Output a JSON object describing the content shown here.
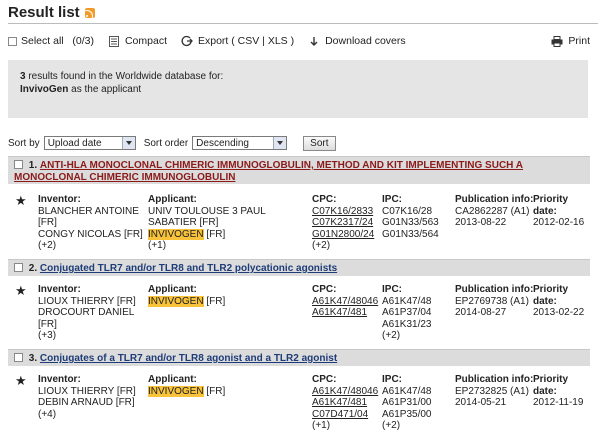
{
  "header": {
    "title": "Result list",
    "rss_icon": "rss-icon"
  },
  "toolbar": {
    "select_all": "Select all",
    "select_count": "(0/3)",
    "compact": "Compact",
    "export": "Export",
    "export_formats": "( CSV | XLS )",
    "download": "Download covers",
    "print": "Print"
  },
  "summary": {
    "count": "3",
    "line1_rest": " results found in the Worldwide database for:",
    "query": "InvivoGen",
    "line2_rest": " as the applicant"
  },
  "sort": {
    "sort_by_label": "Sort by",
    "sort_by_value": "Upload date",
    "sort_order_label": "Sort order",
    "sort_order_value": "Descending",
    "sort_button": "Sort"
  },
  "labels": {
    "inventor": "Inventor:",
    "applicant": "Applicant:",
    "cpc": "CPC:",
    "ipc": "IPC:",
    "publication": "Publication info:",
    "priority": "Priority date:"
  },
  "results": [
    {
      "num": "1.",
      "title": "ANTI-HLA MONOCLONAL CHIMERIC IMMUNOGLOBULIN, METHOD AND KIT IMPLEMENTING SUCH A MONOCLONAL CHIMERIC IMMUNOGLOBULIN",
      "inventors": [
        "BLANCHER ANTOINE",
        "[FR]",
        "CONGY NICOLAS  [FR]",
        "(+2)"
      ],
      "applicants": [
        "UNIV TOULOUSE 3 PAUL",
        "SABATIER  [FR]"
      ],
      "applicant_highlight": "INVIVOGEN",
      "applicant_highlight_suffix": "  [FR]",
      "applicant_more": "(+1)",
      "cpc": [
        "C07K16/2833",
        "C07K2317/24",
        "G01N2800/24"
      ],
      "cpc_more": "(+2)",
      "ipc": [
        "C07K16/28",
        "G01N33/563",
        "G01N33/564"
      ],
      "ipc_more": "",
      "pub_number": "CA2862287 (A1)",
      "pub_date": "2013-08-22",
      "priority": "2012-02-16"
    },
    {
      "num": "2.",
      "title": "Conjugated TLR7 and/or TLR8 and TLR2 polycationic agonists",
      "inventors": [
        "LIOUX THIERRY  [FR]",
        "DROCOURT DANIEL",
        "[FR]",
        "(+3)"
      ],
      "applicants": [],
      "applicant_highlight": "INVIVOGEN",
      "applicant_highlight_suffix": "  [FR]",
      "applicant_more": "",
      "cpc": [
        "A61K47/48046",
        "A61K47/481"
      ],
      "cpc_more": "",
      "ipc": [
        "A61K47/48",
        "A61P37/04",
        "A61K31/23"
      ],
      "ipc_more": "(+2)",
      "pub_number": "EP2769738 (A1)",
      "pub_date": "2014-08-27",
      "priority": "2013-02-22"
    },
    {
      "num": "3.",
      "title": "Conjugates of a TLR7 and/or TLR8 agonist and a TLR2 agonist",
      "inventors": [
        "LIOUX THIERRY  [FR]",
        "DEBIN ARNAUD  [FR]",
        "(+4)"
      ],
      "applicants": [],
      "applicant_highlight": "INVIVOGEN",
      "applicant_highlight_suffix": "  [FR]",
      "applicant_more": "",
      "cpc": [
        "A61K47/48046",
        "A61K47/481",
        "C07D471/04"
      ],
      "cpc_more": "(+1)",
      "ipc": [
        "A61K47/48",
        "A61P31/00",
        "A61P35/00"
      ],
      "ipc_more": "(+2)",
      "pub_number": "EP2732825 (A1)",
      "pub_date": "2014-05-21",
      "priority": "2012-11-19"
    }
  ],
  "colors": {
    "highlight": "#f8c23a",
    "header_bg": "#dcdcdc",
    "title_link": "#8b1a1a",
    "summary_bg": "#e5e5e5"
  }
}
